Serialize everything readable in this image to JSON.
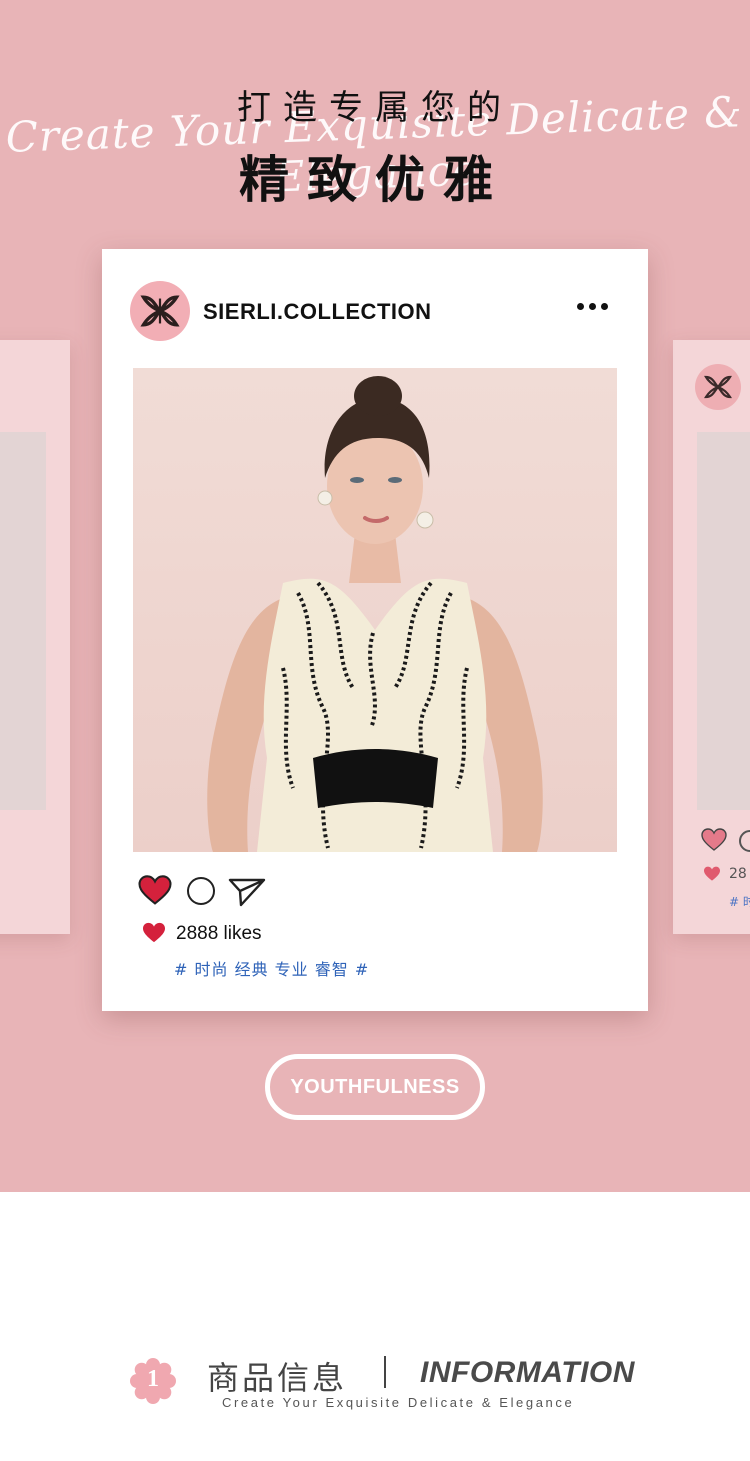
{
  "hero": {
    "script_line": "Create Your Exquisite Delicate & Elegance",
    "title_line1": "打造专属您的",
    "title_line2": "精致优雅",
    "background_color": "#e8b4b7"
  },
  "post": {
    "handle": "SIERLI.COLLECTION",
    "logo_icon": "sierli-monogram-logo",
    "more_icon": "more-dots-icon",
    "likes": "2888 likes",
    "tags": "# 时尚 经典 专业 睿智 #",
    "heart_color": "#d4213c"
  },
  "side_card_right": {
    "likes_partial": "28",
    "tag_partial": "# 时"
  },
  "pill": {
    "label": "YOUTHFULNESS"
  },
  "info": {
    "number": "1",
    "title_cn": "商品信息",
    "title_en": "INFORMATION",
    "subtitle": "Create Your Exquisite Delicate & Elegance",
    "badge_color": "#f0a8b0"
  }
}
